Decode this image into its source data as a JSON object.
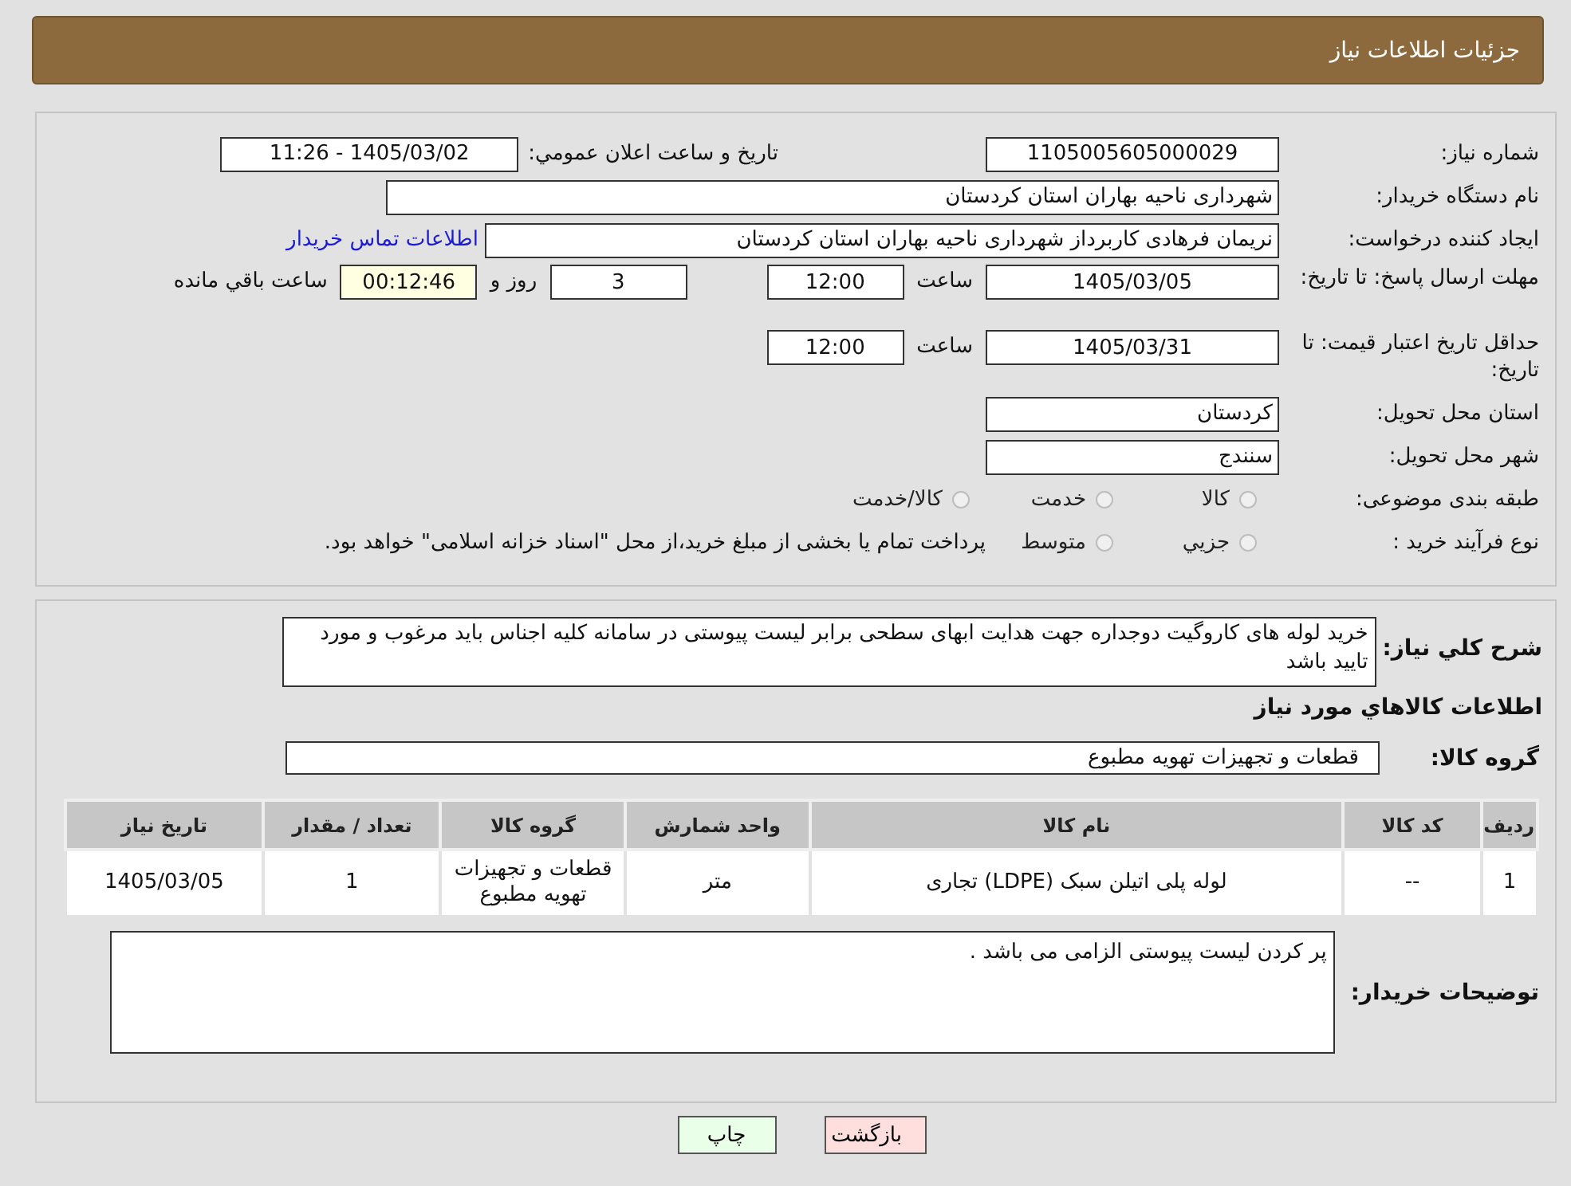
{
  "header": {
    "title": "جزئیات اطلاعات نیاز"
  },
  "details": {
    "need_number": {
      "label": "شماره نیاز:",
      "value": "1105005605000029"
    },
    "announce": {
      "label": "تاریخ و ساعت اعلان عمومي:",
      "value": "1405/03/02 - 11:26"
    },
    "buyer": {
      "label": "نام دستگاه خریدار:",
      "value": "شهرداری ناحیه بهاران استان کردستان"
    },
    "requester": {
      "label": "ایجاد کننده درخواست:",
      "value": "نریمان فرهادی کاربرداز شهرداری ناحیه بهاران استان کردستان",
      "link": "اطلاعات تماس خریدار"
    },
    "deadline": {
      "label": "مهلت ارسال پاسخ: تا تاریخ:",
      "date": "1405/03/05",
      "time_label": "ساعت",
      "time": "12:00",
      "days": "3",
      "days_label": "روز و",
      "remaining": "00:12:46",
      "remaining_label": "ساعت باقي مانده"
    },
    "validity": {
      "label": "حداقل تاریخ اعتبار قیمت: تا تاریخ:",
      "date": "1405/03/31",
      "time_label": "ساعت",
      "time": "12:00"
    },
    "province": {
      "label": "استان محل تحویل:",
      "value": "کردستان"
    },
    "city": {
      "label": "شهر محل تحویل:",
      "value": "سنندج"
    },
    "category": {
      "label": "طبقه بندی موضوعی:",
      "options": [
        {
          "label": "كالا",
          "selected": false
        },
        {
          "label": "خدمت",
          "selected": false
        },
        {
          "label": "كالا/خدمت",
          "selected": false
        }
      ]
    },
    "process": {
      "label": "نوع فرآیند خرید :",
      "options": [
        {
          "label": "جزيي",
          "selected": false
        },
        {
          "label": "متوسط",
          "selected": false
        }
      ],
      "note": "پرداخت تمام یا بخشی از مبلغ خرید،از محل \"اسناد خزانه اسلامی\" خواهد بود."
    }
  },
  "goods": {
    "description_label": "شرح کلي نیاز:",
    "description": "خرید لوله های کاروگیت دوجداره جهت هدایت ابهای سطحی برابر لیست پیوستی در سامانه کلیه اجناس باید مرغوب و مورد تایید باشد",
    "heading": "اطلاعات کالاهاي مورد نیاز",
    "group_label": "گروه کالا:",
    "group": "قطعات و تجهیزات تهویه مطبوع",
    "table": {
      "columns": [
        "ردیف",
        "کد کالا",
        "نام کالا",
        "واحد شمارش",
        "گروه کالا",
        "تعداد / مقدار",
        "تاریخ نیاز"
      ],
      "rows": [
        [
          "1",
          "--",
          "لوله پلی اتیلن سبک (LDPE) تجاری",
          "متر",
          "قطعات و تجهیزات تهویه مطبوع",
          "1",
          "1405/03/05"
        ]
      ]
    },
    "notes_label": "توضیحات خریدار:",
    "notes": "پر کردن لیست پیوستی الزامی می باشد ."
  },
  "buttons": [
    {
      "label": "بازگشت",
      "kind": "back"
    },
    {
      "label": "چاپ",
      "kind": "print"
    }
  ]
}
